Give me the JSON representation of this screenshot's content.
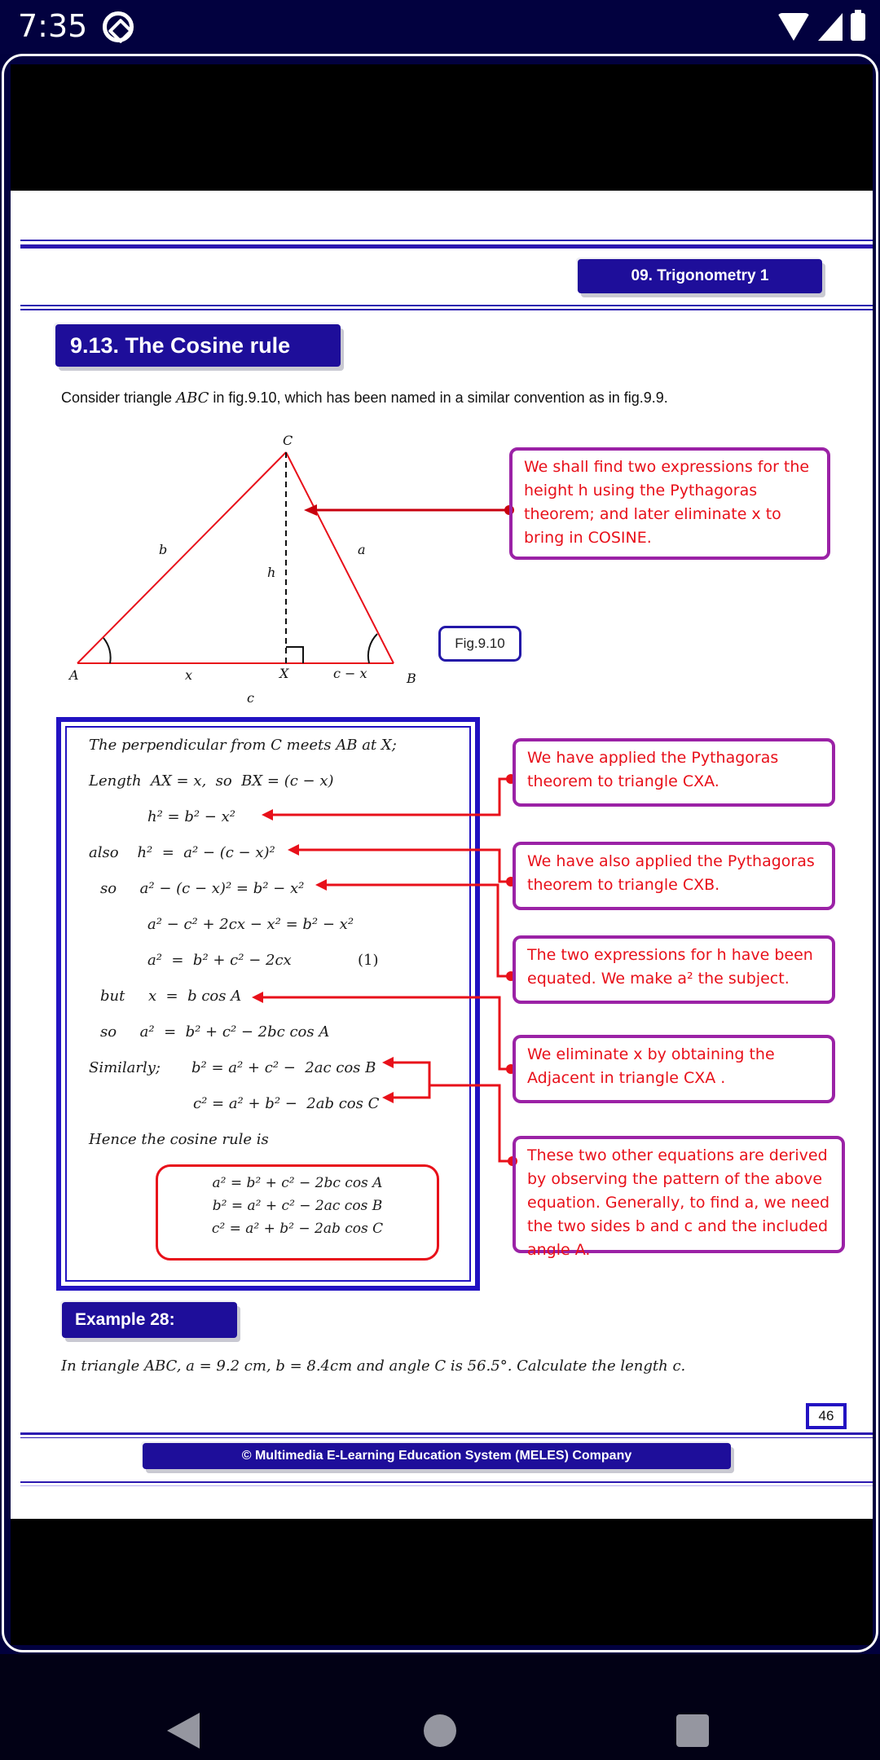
{
  "status_bar": {
    "time": "7:35",
    "icons": [
      "app-notification-icon",
      "wifi-icon",
      "signal-icon",
      "battery-icon"
    ]
  },
  "header": {
    "chapter": "09. Trigonometry 1"
  },
  "section": {
    "title": "9.13. The Cosine rule",
    "intro_prefix": "Consider triangle ",
    "intro_var": "ABC",
    "intro_suffix": " in fig.9.10, which has been named in a similar convention as in fig.9.9."
  },
  "figure": {
    "label": "Fig.9.10",
    "vertices": {
      "A": "A",
      "B": "B",
      "C": "C",
      "X": "X"
    },
    "sides": {
      "a": "a",
      "b": "b",
      "c": "c",
      "h": "h",
      "x": "x",
      "cx": "c − x"
    }
  },
  "notes": [
    {
      "text": "We shall find two expressions for the height h using the Pythagoras theorem; and later eliminate x to bring in COSINE."
    },
    {
      "text": "We have applied the Pythagoras theorem to triangle CXA."
    },
    {
      "text": "We have also applied the Pythagoras theorem to triangle CXB."
    },
    {
      "text": "The two expressions for h have been equated. We make a² the subject."
    },
    {
      "text": "We eliminate x by obtaining the Adjacent in triangle CXA ."
    },
    {
      "text": "These two other equations are derived by observing the pattern of the above equation. Generally, to find a, we need the two sides b and c and the included angle A."
    }
  ],
  "derivation": [
    "The perpendicular from C meets AB at X;",
    "Length  AX = x,  so  BX = (c − x)",
    "h² = b² − x²",
    "also    h²  =  a² − (c − x)²",
    "so     a² − (c − x)² = b² − x²",
    "a² − c² + 2cx − x² = b² − x²",
    "a²  =  b² + c² − 2cx",
    "(1)",
    "but     x  =  b cos A",
    "so     a²  =  b² + c² − 2bc cos A",
    "Similarly;",
    "b² = a² + c² −  2ac cos B",
    "c² = a² + b² −  2ab cos C",
    "Hence the cosine rule is"
  ],
  "cosine_rule": [
    "a² = b² + c² − 2bc cos A",
    "b² = a² + c² −  2ac cos B",
    "c²  = a² + b² −  2ab cos C"
  ],
  "example": {
    "title": "Example 28:",
    "text": "In triangle  ABC,  a = 9.2 cm,  b = 8.4cm and  angle C is  56.5°. Calculate the length  c."
  },
  "page_number": "46",
  "footer": "© Multimedia E-Learning Education System (MELES) Company",
  "nav": {
    "buttons": [
      "back",
      "home",
      "recents"
    ]
  }
}
